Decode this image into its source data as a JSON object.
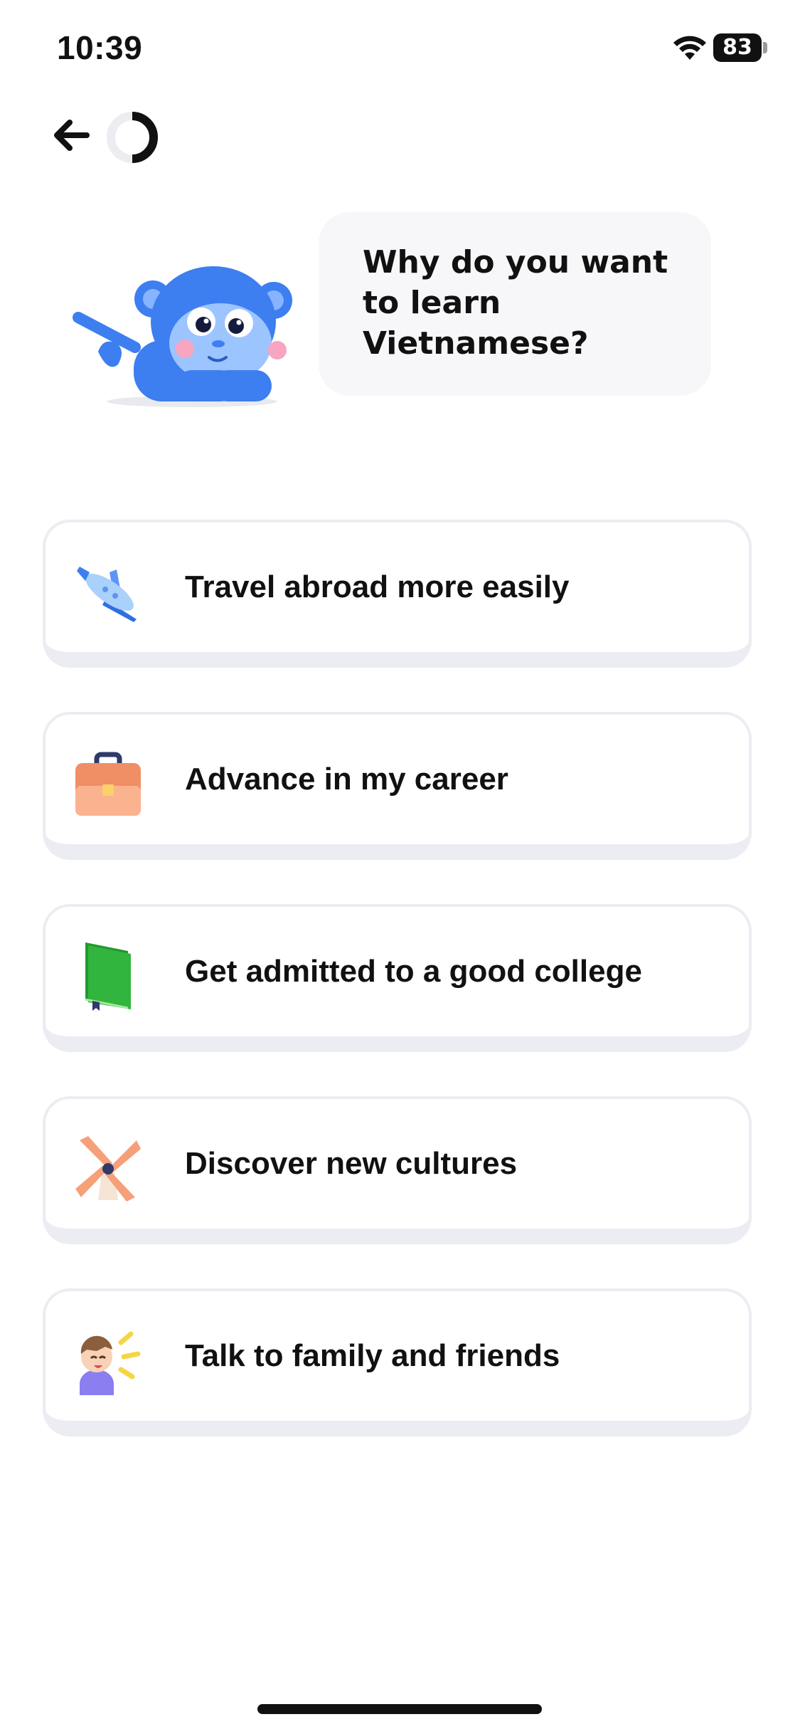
{
  "status_bar": {
    "time": "10:39",
    "battery": "83"
  },
  "header": {
    "back_icon": "arrow-left-icon",
    "progress_icon": "progress-ring-icon",
    "progress_fraction": 0.5
  },
  "prompt": {
    "question": "Why do you want to learn Vietnamese?",
    "mascot_icon": "blue-monkey-mascot"
  },
  "options": [
    {
      "label": "Travel abroad more easily",
      "icon": "airplane-icon"
    },
    {
      "label": "Advance in my career",
      "icon": "briefcase-icon"
    },
    {
      "label": "Get admitted to a good college",
      "icon": "book-icon"
    },
    {
      "label": "Discover new cultures",
      "icon": "windmill-icon"
    },
    {
      "label": "Talk to family and friends",
      "icon": "person-talking-icon"
    }
  ],
  "colors": {
    "mascot_blue": "#3d7ef0",
    "option_border": "#ececf3",
    "bubble_bg": "#f7f7f9"
  }
}
